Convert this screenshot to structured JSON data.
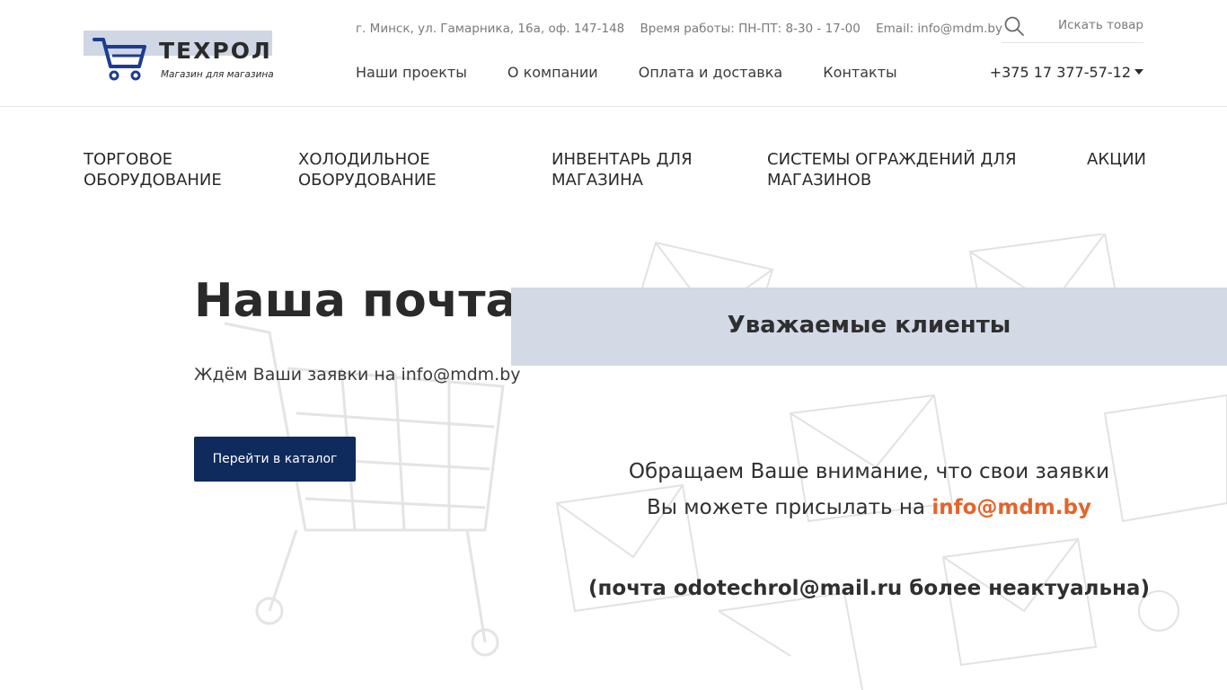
{
  "brand": {
    "name": "ТЕХРОЛ",
    "tagline": "Магазин для магазина",
    "accent_color": "#1c3d8f"
  },
  "topbar": {
    "address": "г. Минск, ул. Гамарника, 16а, оф. 147-148",
    "hours": "Время работы: ПН-ПТ: 8-30 - 17-00",
    "email": "Email: info@mdm.by"
  },
  "search": {
    "placeholder": "Искать товар",
    "icon": "search-icon"
  },
  "mainnav": {
    "items": [
      {
        "label": "Наши проекты"
      },
      {
        "label": "О компании"
      },
      {
        "label": "Оплата и доставка"
      },
      {
        "label": "Контакты"
      }
    ]
  },
  "phone": {
    "number": "+375 17 377-57-12",
    "icon": "chevron-down-icon"
  },
  "catnav": {
    "items": [
      {
        "line1": "Торговое",
        "line2": "оборудование"
      },
      {
        "line1": "Холодильное",
        "line2": "оборудование"
      },
      {
        "line1": "Инвентарь для",
        "line2": "магазина"
      },
      {
        "line1": "Системы ограждений для",
        "line2": "магазинов"
      },
      {
        "line1": "Акции",
        "line2": ""
      }
    ]
  },
  "hero": {
    "title": "Наша почта",
    "subtitle": "Ждём Ваши заявки на info@mdm.by",
    "button_label": "Перейти в каталог",
    "button_color": "#0f2a5c"
  },
  "notice": {
    "heading": "Уважаемые клиенты",
    "line1": "Обращаем Ваше внимание, что свои заявки",
    "line2_prefix": "Вы можете присылать на",
    "line2_email": "info@mdm.by",
    "line3": "(почта odotechrol@mail.ru более неактуальна)",
    "email_color": "#e4642a",
    "heading_bg": "#d3d9e5"
  }
}
